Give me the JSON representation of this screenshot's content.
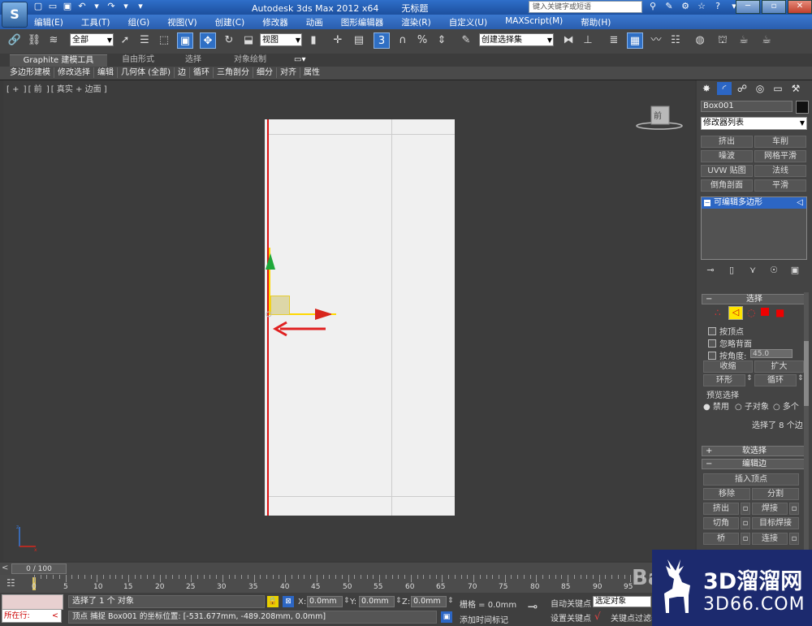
{
  "titlebar": {
    "app_logo": "S",
    "title": "Autodesk 3ds Max  2012  x64",
    "document": "无标题",
    "search_placeholder": "键入关键字或短语"
  },
  "menu": [
    "编辑(E)",
    "工具(T)",
    "组(G)",
    "视图(V)",
    "创建(C)",
    "修改器",
    "动画",
    "图形编辑器",
    "渲染(R)",
    "自定义(U)",
    "MAXScript(M)",
    "帮助(H)"
  ],
  "toolbar": {
    "selection_filter": "全部",
    "ref_coord": "视图",
    "named_selection": "创建选择集"
  },
  "ribbon": {
    "tabs": [
      "Graphite 建模工具",
      "自由形式",
      "选择",
      "对象绘制"
    ],
    "items": [
      "多边形建模",
      "修改选择",
      "编辑",
      "几何体 (全部)",
      "边",
      "循环",
      "三角剖分",
      "细分",
      "对齐",
      "属性"
    ]
  },
  "viewport": {
    "label_plus": "+",
    "label_view": "前",
    "label_shading": "真实 + 边面",
    "viewcube_face": "前"
  },
  "command_panel": {
    "object_name": "Box001",
    "object_color": "#111111",
    "modifier_list": "修改器列表",
    "modifier_buttons": [
      "挤出",
      "车削",
      "噪波",
      "网格平滑",
      "UVW 贴图",
      "法线",
      "倒角剖面",
      "平滑"
    ],
    "stack_item": "可编辑多边形",
    "selection": {
      "title": "选择",
      "by_vertex": "按顶点",
      "ignore_backfacing": "忽略背面",
      "by_angle": "按角度:",
      "angle_value": "45.0",
      "shrink": "收缩",
      "grow": "扩大",
      "ring": "环形",
      "loop": "循环",
      "preview_title": "预览选择",
      "preview_off": "禁用",
      "preview_subobj": "子对象",
      "preview_multi": "多个",
      "selected_info": "选择了 8 个边"
    },
    "soft_selection": "软选择",
    "edit_edges": {
      "title": "编辑边",
      "insert_vertex": "插入顶点",
      "remove": "移除",
      "split": "分割",
      "extrude": "挤出",
      "weld": "焊接",
      "chamfer": "切角",
      "target_weld": "目标焊接",
      "bridge": "桥",
      "connect": "连接"
    }
  },
  "timeline": {
    "frame": "0 / 100",
    "ticks": [
      "0",
      "5",
      "10",
      "15",
      "20",
      "25",
      "30",
      "35",
      "40",
      "45",
      "50",
      "55",
      "60",
      "65",
      "70",
      "75",
      "80",
      "85",
      "90",
      "95"
    ]
  },
  "status": {
    "running": "所在行:",
    "selected": "选择了 1 个 对象",
    "prompt": "顶点 捕捉 Box001 的坐标位置: [-531.677mm, -489.208mm, 0.0mm]",
    "x_label": "X:",
    "x_value": "0.0mm",
    "y_label": "Y:",
    "y_value": "0.0mm",
    "z_label": "Z:",
    "z_value": "0.0mm",
    "grid": "栅格 = 0.0mm",
    "add_time_tag": "添加时间标记",
    "auto_key": "自动关键点",
    "set_key": "设置关键点",
    "selected_object": "选定对象",
    "key_filters": "关键点过滤器..."
  },
  "watermark": {
    "baidu": "Bai",
    "site_title": "3D溜溜网",
    "site_url": "3D66.COM"
  },
  "colors": {
    "selected_edge": "#dd1111",
    "gizmo": "#ffd800",
    "annotation_arrow": "#e02020",
    "accent": "#2c66c4"
  }
}
